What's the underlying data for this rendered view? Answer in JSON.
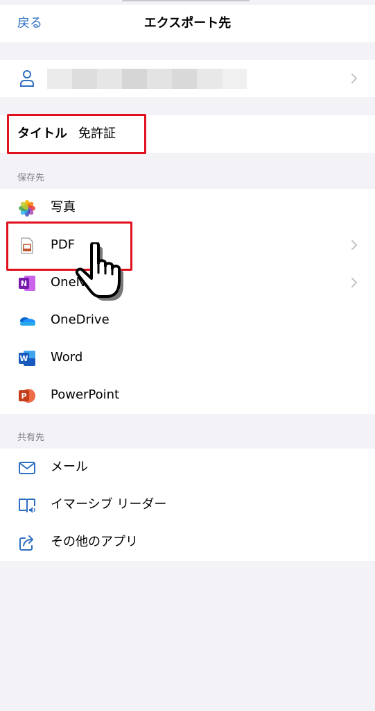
{
  "nav": {
    "back_label": "戻る",
    "title": "エクスポート先"
  },
  "account": {
    "icon": "person-icon"
  },
  "title_field": {
    "label": "タイトル",
    "value": "免許証"
  },
  "save_section": {
    "header": "保存先",
    "items": [
      {
        "label": "写真",
        "icon": "photos-icon"
      },
      {
        "label": "PDF",
        "icon": "pdf-icon"
      },
      {
        "label": "OneN",
        "icon": "onenote-icon"
      },
      {
        "label": "OneDrive",
        "icon": "onedrive-icon"
      },
      {
        "label": "Word",
        "icon": "word-icon"
      },
      {
        "label": "PowerPoint",
        "icon": "powerpoint-icon"
      }
    ]
  },
  "share_section": {
    "header": "共有先",
    "items": [
      {
        "label": "メール",
        "icon": "mail-icon"
      },
      {
        "label": "イマーシブ リーダー",
        "icon": "immersive-reader-icon"
      },
      {
        "label": "その他のアプリ",
        "icon": "share-icon"
      }
    ]
  },
  "colors": {
    "accent": "#2f6fc1",
    "highlight": "#e0101d",
    "background": "#f2f2f7"
  }
}
